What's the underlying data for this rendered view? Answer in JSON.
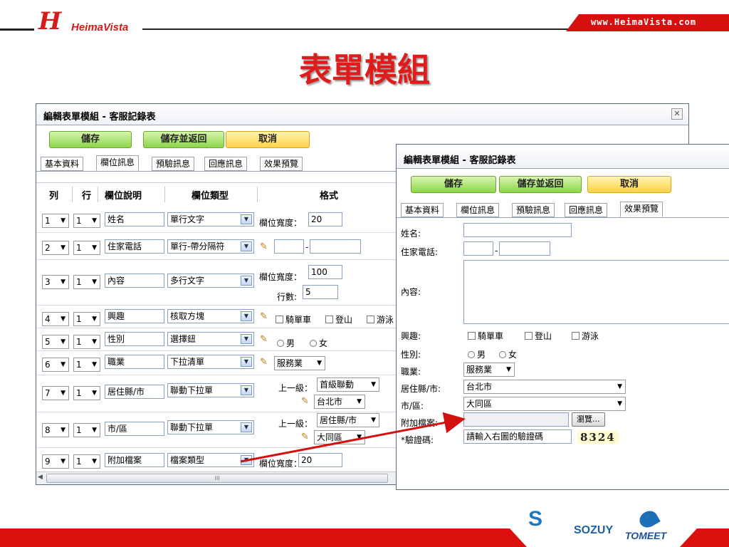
{
  "header": {
    "logo_mark": "H",
    "logo_word": "HeimaVista",
    "url": "www.HeimaVista.com",
    "title": "表單模組"
  },
  "editor_left": {
    "title": "編輯表單模組 - 客服記錄表",
    "buttons": {
      "save": "儲存",
      "save_return": "儲存並返回",
      "cancel": "取消"
    },
    "tabs": [
      "基本資料",
      "欄位訊息",
      "預驗訊息",
      "回應訊息",
      "效果預覽"
    ],
    "active_tab": "欄位訊息",
    "columns": {
      "col": "列",
      "row": "行",
      "desc": "欄位說明",
      "type": "欄位類型",
      "format": "格式"
    },
    "rows": [
      {
        "col": "1",
        "row": "1",
        "desc": "姓名",
        "type": "單行文字",
        "format_label": "欄位寬度：",
        "format_value": "20"
      },
      {
        "col": "2",
        "row": "1",
        "desc": "住家電話",
        "type": "單行-帶分隔符",
        "sep": "-"
      },
      {
        "col": "3",
        "row": "1",
        "desc": "內容",
        "type": "多行文字",
        "format_label": "欄位寬度：",
        "format_value": "100",
        "rows_label": "行數:",
        "rows_value": "5"
      },
      {
        "col": "4",
        "row": "1",
        "desc": "興趣",
        "type": "核取方塊",
        "options": [
          "騎單車",
          "登山",
          "游泳"
        ]
      },
      {
        "col": "5",
        "row": "1",
        "desc": "性別",
        "type": "選擇鈕",
        "options": [
          "男",
          "女"
        ]
      },
      {
        "col": "6",
        "row": "1",
        "desc": "職業",
        "type": "下拉清單",
        "selected": "服務業"
      },
      {
        "col": "7",
        "row": "1",
        "desc": "居住縣/市",
        "type": "聯動下拉單",
        "parent_label": "上一級：",
        "parent_value": "首級聯動",
        "selected": "台北市"
      },
      {
        "col": "8",
        "row": "1",
        "desc": "市/區",
        "type": "聯動下拉單",
        "parent_label": "上一級：",
        "parent_value": "居住縣/市",
        "selected": "大同區"
      },
      {
        "col": "9",
        "row": "1",
        "desc": "附加檔案",
        "type": "檔案類型",
        "format_label": "欄位寬度：",
        "format_value": "20"
      }
    ],
    "scroll_grip": "III"
  },
  "editor_right": {
    "title": "編輯表單模組 - 客服記錄表",
    "buttons": {
      "save": "儲存",
      "save_return": "儲存並返回",
      "cancel": "取消"
    },
    "tabs": [
      "基本資料",
      "欄位訊息",
      "預驗訊息",
      "回應訊息",
      "效果預覽"
    ],
    "active_tab": "效果預覽",
    "preview": {
      "name_label": "姓名:",
      "phone_label": "住家電話:",
      "phone_sep": "-",
      "content_label": "內容:",
      "interest_label": "興趣:",
      "interest_options": [
        "騎單車",
        "登山",
        "游泳"
      ],
      "gender_label": "性別:",
      "gender_options": [
        "男",
        "女"
      ],
      "job_label": "職業:",
      "job_value": "服務業",
      "city_label": "居住縣/市:",
      "city_value": "台北市",
      "district_label": "市/區:",
      "district_value": "大同區",
      "file_label": "附加檔案:",
      "browse_label": "瀏覽...",
      "captcha_label": "*驗證碼:",
      "captcha_placeholder": "請輸入右圖的驗證碼",
      "captcha_code": "8324"
    }
  },
  "footer": {
    "partners": [
      "S",
      "SOZUY",
      "TOMEET"
    ]
  },
  "colors": {
    "brand_red": "#d61b1b",
    "button_green": "#8cd64a",
    "button_yellow": "#ffd24a",
    "panel_border": "#5a6a80"
  },
  "icons": [
    "close-icon",
    "pencil-icon",
    "chevron-down-icon",
    "arrow-icon"
  ]
}
